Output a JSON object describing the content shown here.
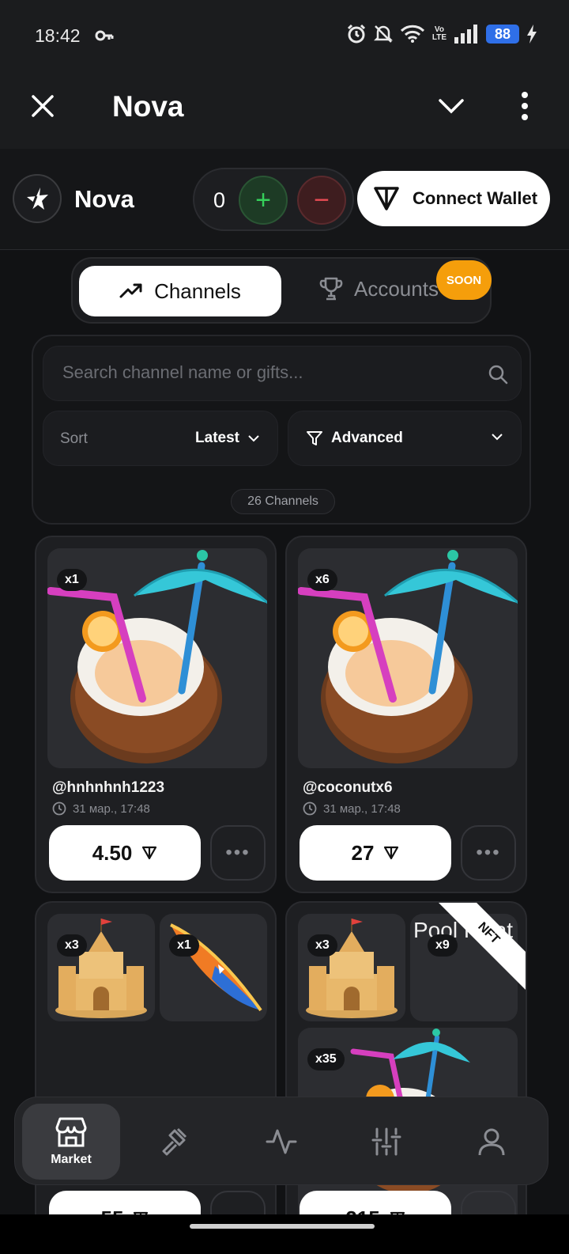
{
  "status_bar": {
    "time": "18:42",
    "battery": "88",
    "volte": "Vo\nLTE"
  },
  "app_bar": {
    "title": "Nova"
  },
  "header": {
    "brand": "Nova",
    "counter_value": "0",
    "plus_label": "+",
    "minus_label": "−",
    "wallet_label": "Connect Wallet"
  },
  "tabs": {
    "active_label": "Channels",
    "inactive_label": "Accounts",
    "soon_badge": "SOON"
  },
  "filters": {
    "search_placeholder": "Search channel name or gifts...",
    "sort_label": "Sort",
    "sort_value": "Latest",
    "advanced_label": "Advanced",
    "channel_count": "26 Channels"
  },
  "cards": [
    {
      "quantity": "x1",
      "handle": "@hnhnhnh1223",
      "date": "31 мар., 17:48",
      "price": "4.50",
      "more": "•••"
    },
    {
      "quantity": "x6",
      "handle": "@coconutx6",
      "date": "31 мар., 17:48",
      "price": "27",
      "more": "•••"
    },
    {
      "gifts": [
        {
          "quantity": "x3"
        },
        {
          "quantity": "x1"
        }
      ],
      "price": "55",
      "more": "•••"
    },
    {
      "gifts": [
        {
          "quantity": "x3"
        },
        {
          "quantity": "x9",
          "broken_alt": "Pool Float"
        },
        {
          "quantity": "x35"
        }
      ],
      "nft_badge": "NFT",
      "price": "215",
      "more": "•••"
    }
  ],
  "bottom_nav": {
    "market_label": "Market"
  },
  "colors": {
    "accent_orange": "#f59e0b",
    "plus_green": "#35d05a",
    "minus_red": "#e94c54",
    "battery_blue": "#2f6fe8"
  }
}
